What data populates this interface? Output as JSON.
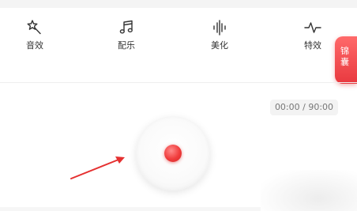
{
  "toolbar": {
    "items": [
      {
        "label": "音效",
        "icon": "magic-wand-icon"
      },
      {
        "label": "配乐",
        "icon": "music-note-icon"
      },
      {
        "label": "美化",
        "icon": "waveform-icon"
      },
      {
        "label": "特效",
        "icon": "pulse-icon"
      }
    ]
  },
  "side_tab": {
    "label_line1": "锦",
    "label_line2": "囊"
  },
  "recorder": {
    "time": "00:00 / 90:00"
  },
  "colors": {
    "accent": "#f03c3c",
    "side_tab": "#e8393f",
    "arrow": "#e53030"
  }
}
